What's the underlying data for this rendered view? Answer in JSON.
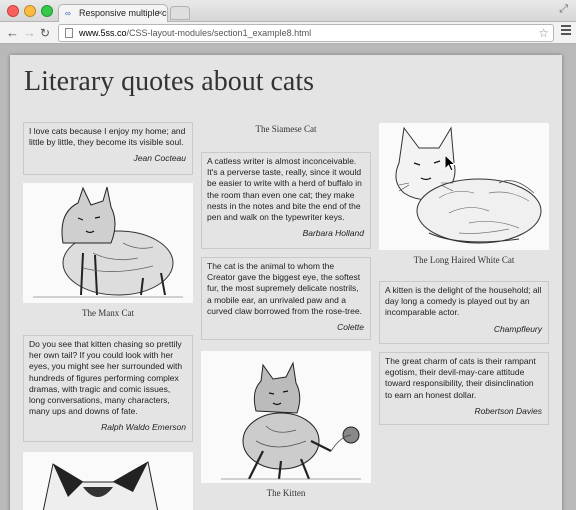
{
  "browser": {
    "tab_title": "Responsive multiple column",
    "url_host": "www.5ss.co",
    "url_path": "/CSS-layout-modules/section1_example8.html"
  },
  "page": {
    "title": "Literary quotes about cats"
  },
  "quotes": [
    {
      "text": "I love cats because I enjoy my home; and little by little, they become its visible soul.",
      "author": "Jean Cocteau"
    },
    {
      "text": "Do you see that kitten chasing so prettily her own tail? If you could look with her eyes, you might see her surrounded with hundreds of figures performing complex dramas, with tragic and comic issues, long conversations, many characters, many ups and downs of fate.",
      "author": "Ralph Waldo Emerson"
    },
    {
      "text": "A catless writer is almost inconceivable. It's a perverse taste, really, since it would be easier to write with a herd of buffalo in the room than even one cat; they make nests in the notes and bite the end of the pen and walk on the typewriter keys.",
      "author": "Barbara Holland"
    },
    {
      "text": "The cat is the animal to whom the Creator gave the biggest eye, the softest fur, the most supremely delicate nostrils, a mobile ear, an unrivaled paw and a curved claw borrowed from the rose-tree.",
      "author": "Colette"
    },
    {
      "text": "A kitten is the delight of the household; all day long a comedy is played out by an incomparable actor.",
      "author": "Champfleury"
    },
    {
      "text": "The great charm of cats is their rampant egotism, their devil-may-care attitude toward responsibility, their disinclination to earn an honest dollar.",
      "author": "Robertson Davies"
    }
  ],
  "captions": {
    "manx": "The Manx Cat",
    "siamese": "The Siamese Cat",
    "kitten": "The Kitten",
    "longhair": "The Long Haired White Cat"
  }
}
